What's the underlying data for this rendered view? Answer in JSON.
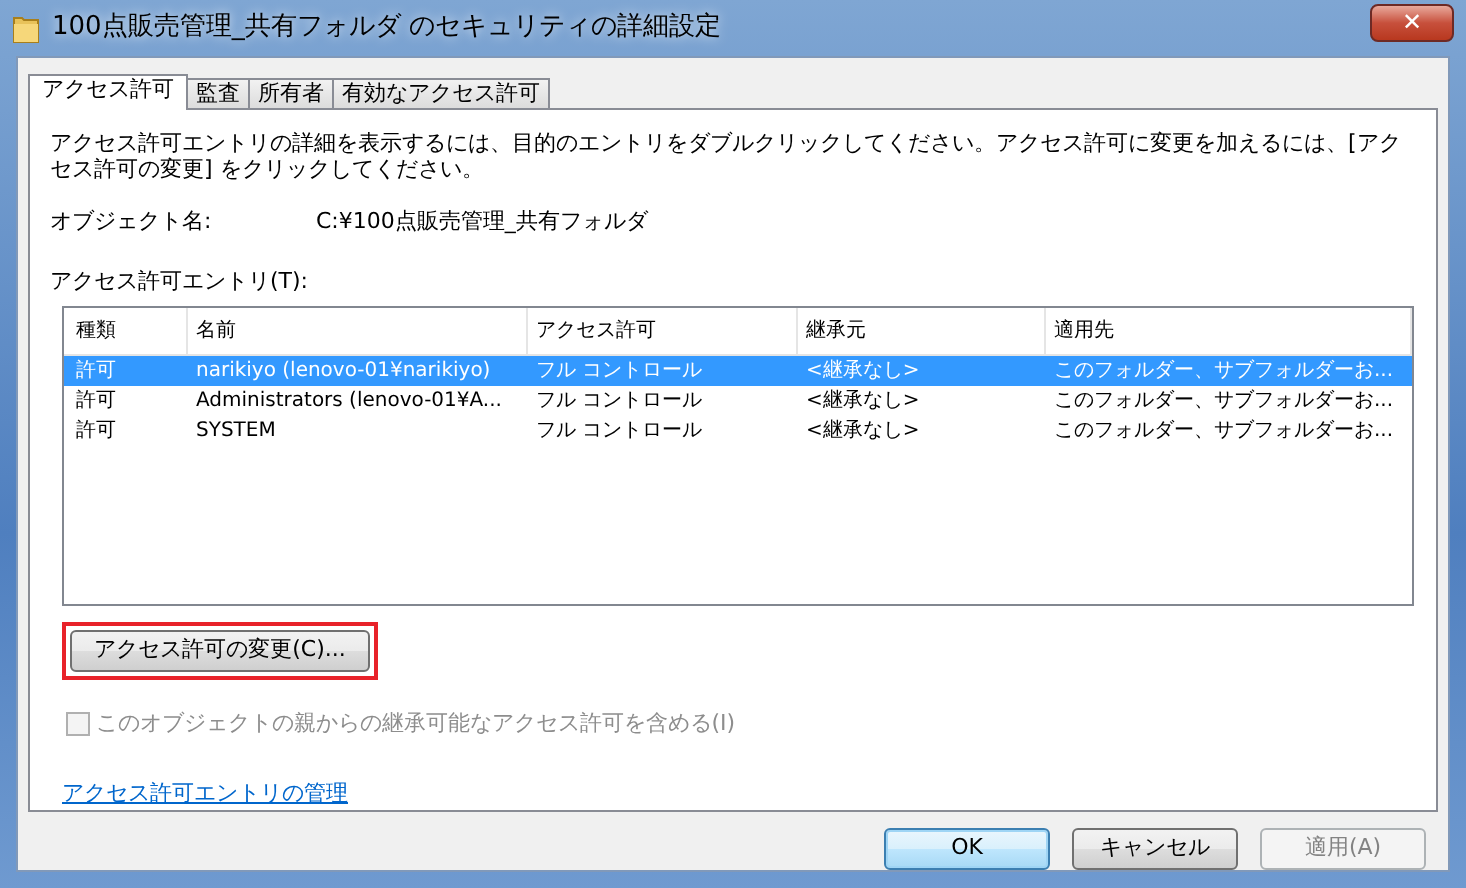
{
  "window": {
    "title": "100点販売管理_共有フォルダ のセキュリティの詳細設定",
    "close_label": "✕"
  },
  "tabs": [
    {
      "label": "アクセス許可",
      "selected": true
    },
    {
      "label": "監査",
      "selected": false
    },
    {
      "label": "所有者",
      "selected": false
    },
    {
      "label": "有効なアクセス許可",
      "selected": false
    }
  ],
  "description": "アクセス許可エントリの詳細を表示するには、目的のエントリをダブルクリックしてください。アクセス許可に変更を加えるには、[アクセス許可の変更] をクリックしてください。",
  "object_name": {
    "label": "オブジェクト名:",
    "value": "C:¥100点販売管理_共有フォルダ"
  },
  "entries_label": "アクセス許可エントリ(T):",
  "table": {
    "columns": [
      "種類",
      "名前",
      "アクセス許可",
      "継承元",
      "適用先"
    ],
    "rows": [
      {
        "cells": [
          "許可",
          "narikiyo (lenovo-01¥narikiyo)",
          "フル コントロール",
          "<継承なし>",
          "このフォルダー、サブフォルダーお..."
        ],
        "selected": true
      },
      {
        "cells": [
          "許可",
          "Administrators (lenovo-01¥A...",
          "フル コントロール",
          "<継承なし>",
          "このフォルダー、サブフォルダーお..."
        ],
        "selected": false
      },
      {
        "cells": [
          "許可",
          "SYSTEM",
          "フル コントロール",
          "<継承なし>",
          "このフォルダー、サブフォルダーお..."
        ],
        "selected": false
      }
    ]
  },
  "change_button": {
    "label": "アクセス許可の変更(C)...",
    "highlighted": true
  },
  "inherit_checkbox": {
    "label": "このオブジェクトの親からの継承可能なアクセス許可を含める(I)",
    "checked": false,
    "disabled": true
  },
  "manage_link": "アクセス許可エントリの管理",
  "buttons": [
    {
      "label": "OK",
      "kind": "default"
    },
    {
      "label": "キャンセル",
      "kind": "normal"
    },
    {
      "label": "適用(A)",
      "kind": "disabled"
    }
  ]
}
